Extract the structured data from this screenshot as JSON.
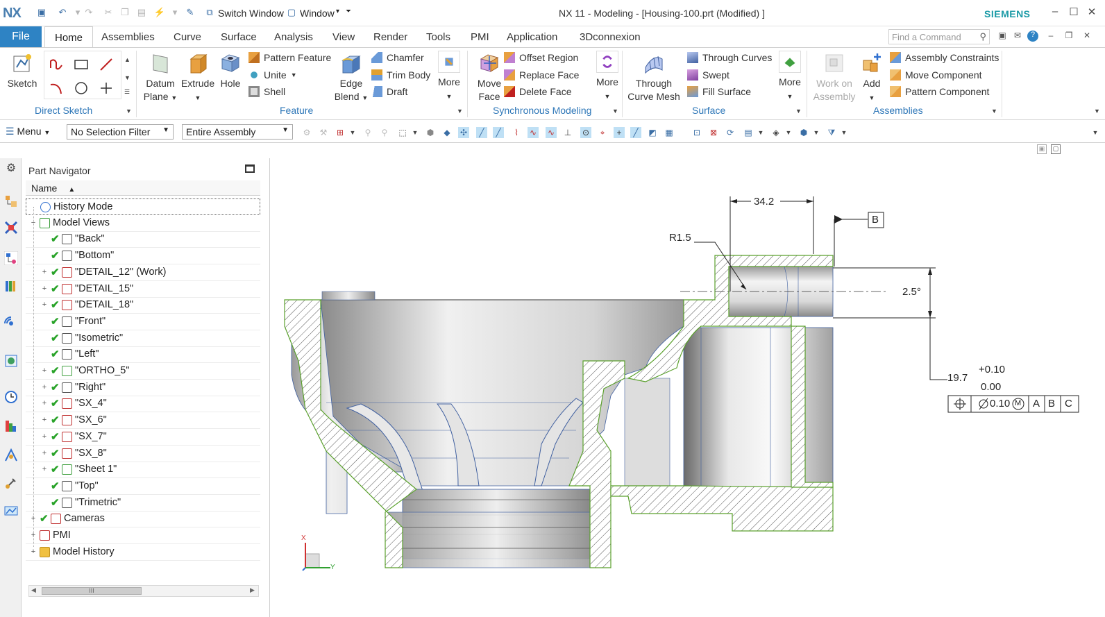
{
  "titlebar": {
    "logo": "NX",
    "switch_window": "Switch Window",
    "window_menu": "Window",
    "title": "NX 11 - Modeling - [Housing-100.prt (Modified) ]",
    "brand": "SIEMENS"
  },
  "tabs": {
    "file": "File",
    "items": [
      "Home",
      "Assemblies",
      "Curve",
      "Surface",
      "Analysis",
      "View",
      "Render",
      "Tools",
      "PMI",
      "Application",
      "3Dconnexion"
    ],
    "active": "Home",
    "find_placeholder": "Find a Command"
  },
  "ribbon": {
    "direct_sketch": {
      "label": "Direct Sketch",
      "sketch": "Sketch"
    },
    "feature": {
      "label": "Feature",
      "datum_plane_1": "Datum",
      "datum_plane_2": "Plane",
      "extrude": "Extrude",
      "hole": "Hole",
      "pattern_feature": "Pattern Feature",
      "unite": "Unite",
      "shell": "Shell",
      "edge_blend_1": "Edge",
      "edge_blend_2": "Blend",
      "chamfer": "Chamfer",
      "trim_body": "Trim Body",
      "draft": "Draft",
      "more": "More"
    },
    "sync_modeling": {
      "label": "Synchronous Modeling",
      "move_face_1": "Move",
      "move_face_2": "Face",
      "offset_region": "Offset Region",
      "replace_face": "Replace Face",
      "delete_face": "Delete Face",
      "more": "More"
    },
    "surface": {
      "label": "Surface",
      "through_curve_mesh_1": "Through",
      "through_curve_mesh_2": "Curve Mesh",
      "through_curves": "Through Curves",
      "swept": "Swept",
      "fill_surface": "Fill Surface",
      "more": "More"
    },
    "assemblies": {
      "label": "Assemblies",
      "work_on_1": "Work on",
      "work_on_2": "Assembly",
      "add": "Add",
      "assembly_constraints": "Assembly Constraints",
      "move_component": "Move Component",
      "pattern_component": "Pattern Component"
    }
  },
  "toolbar2": {
    "menu": "Menu",
    "selection_filter": "No Selection Filter",
    "scope": "Entire Assembly"
  },
  "part_navigator": {
    "title": "Part Navigator",
    "column": "Name",
    "rows": [
      {
        "label": "History Mode",
        "exp": "",
        "check": false
      },
      {
        "label": "Model Views",
        "exp": "−",
        "check": false
      },
      {
        "label": "\"Back\"",
        "exp": "",
        "check": true
      },
      {
        "label": "\"Bottom\"",
        "exp": "",
        "check": true
      },
      {
        "label": "\"DETAIL_12\" (Work)",
        "exp": "+",
        "check": true
      },
      {
        "label": "\"DETAIL_15\"",
        "exp": "+",
        "check": true
      },
      {
        "label": "\"DETAIL_18\"",
        "exp": "+",
        "check": true
      },
      {
        "label": "\"Front\"",
        "exp": "",
        "check": true
      },
      {
        "label": "\"Isometric\"",
        "exp": "",
        "check": true
      },
      {
        "label": "\"Left\"",
        "exp": "",
        "check": true
      },
      {
        "label": "\"ORTHO_5\"",
        "exp": "+",
        "check": true
      },
      {
        "label": "\"Right\"",
        "exp": "+",
        "check": true
      },
      {
        "label": "\"SX_4\"",
        "exp": "+",
        "check": true
      },
      {
        "label": "\"SX_6\"",
        "exp": "+",
        "check": true
      },
      {
        "label": "\"SX_7\"",
        "exp": "+",
        "check": true
      },
      {
        "label": "\"SX_8\"",
        "exp": "+",
        "check": true
      },
      {
        "label": "\"Sheet 1\"",
        "exp": "+",
        "check": true
      },
      {
        "label": "\"Top\"",
        "exp": "",
        "check": true
      },
      {
        "label": "\"Trimetric\"",
        "exp": "",
        "check": true
      },
      {
        "label": "Cameras",
        "exp": "+",
        "check": true
      },
      {
        "label": "PMI",
        "exp": "+",
        "check": false
      },
      {
        "label": "Model History",
        "exp": "+",
        "check": false
      }
    ],
    "scroll_thumb": "III"
  },
  "drawing": {
    "dim_width": "34.2",
    "radius": "R1.5",
    "datum": "B",
    "dim_angle": "2.5°",
    "dim_main": "19.7",
    "tol_upper": "+0.10",
    "tol_lower": "0.00",
    "fcf_tol": "0.10",
    "fcf_mod": "M",
    "fcf_datum_a": "A",
    "fcf_datum_b": "B",
    "fcf_datum_c": "C",
    "triad_x": "X",
    "triad_y": "Y"
  },
  "colors": {
    "accent": "#2e83c4",
    "group_label": "#2e77b8",
    "check": "#29a329",
    "section_edge": "#5aa02c"
  }
}
